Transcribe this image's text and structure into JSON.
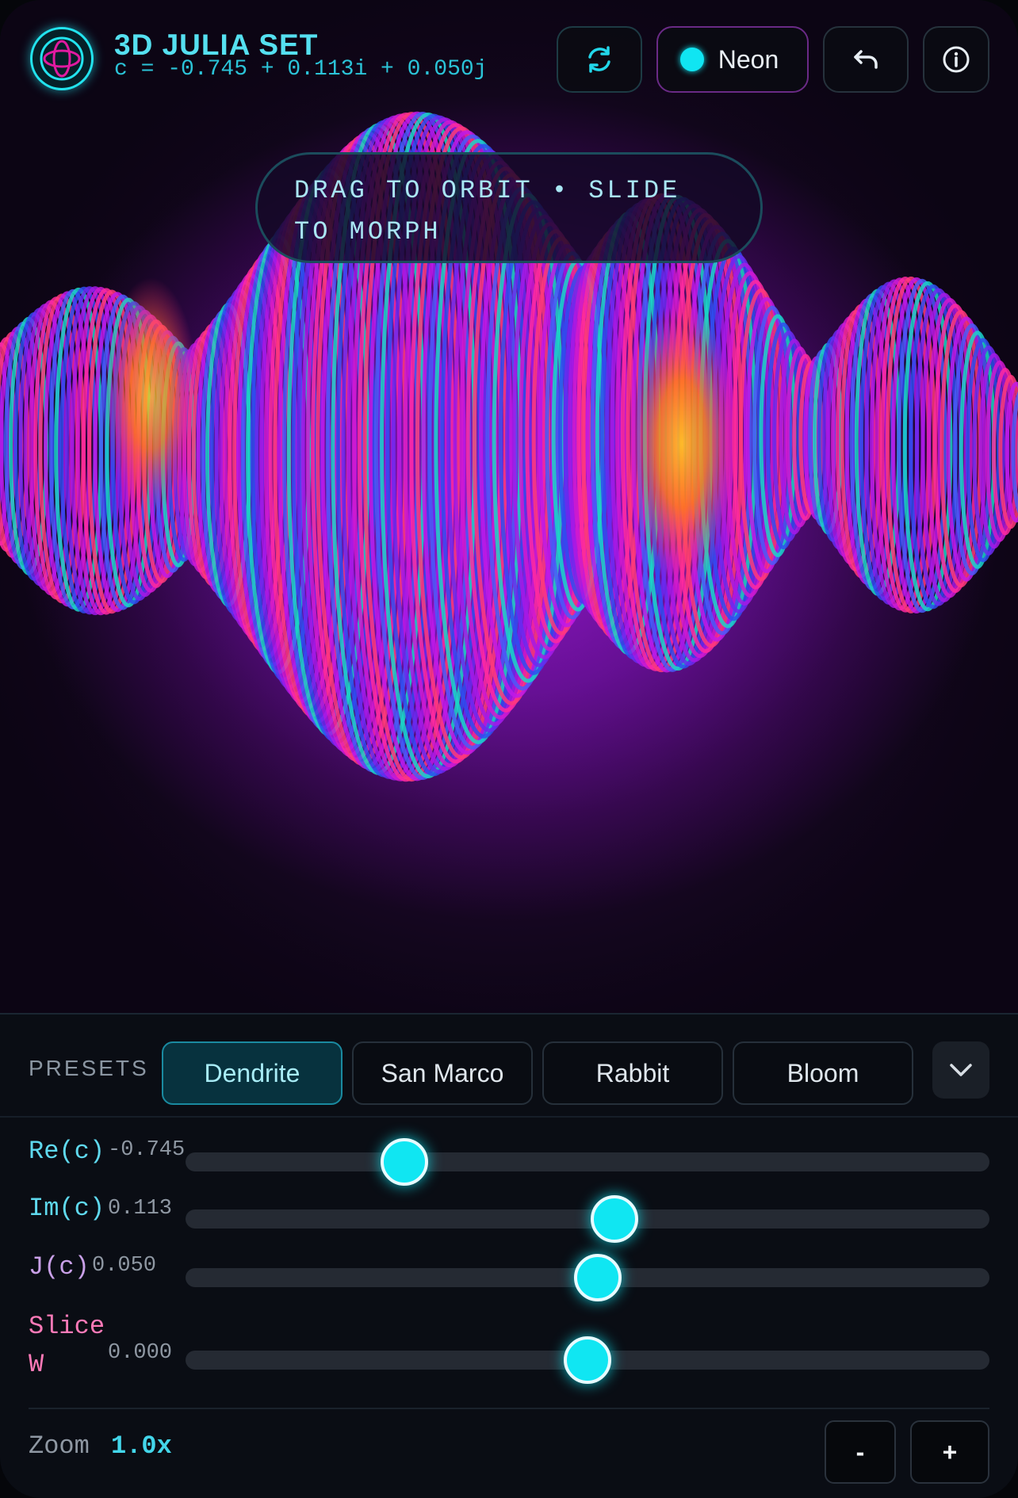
{
  "header": {
    "title": "3D JULIA SET",
    "c_readout": "c = -0.745 + 0.113i + 0.050j",
    "theme_label": "Neon",
    "icons": {
      "logo": "julia-logo-icon",
      "refresh": "refresh-icon",
      "undo": "undo-icon",
      "info": "info-icon"
    }
  },
  "viewport": {
    "hint": "DRAG TO ORBIT • SLIDE TO MORPH"
  },
  "presets": {
    "label": "PRESETS",
    "items": [
      "Dendrite",
      "San Marco",
      "Rabbit",
      "Bloom"
    ],
    "active": "Dendrite"
  },
  "sliders": [
    {
      "label": "Re(c)",
      "value": "-0.745",
      "fraction": 0.272,
      "color": "#5fd9ee"
    },
    {
      "label": "Im(c)",
      "value": "0.113",
      "fraction": 0.534,
      "color": "#5fd9ee"
    },
    {
      "label": "J(c)",
      "value": "0.050",
      "fraction": 0.513,
      "color": "#c9a0e8"
    },
    {
      "label": "Slice W",
      "value": "0.000",
      "fraction": 0.5,
      "color": "#ff7ab8"
    }
  ],
  "zoom": {
    "label": "Zoom",
    "value": "1.0x",
    "minus": "-",
    "plus": "+"
  },
  "colors": {
    "accent": "#10e6f2",
    "magenta": "#e01aa0",
    "purple": "#8a0fc4",
    "orange": "#ff8a1a"
  }
}
